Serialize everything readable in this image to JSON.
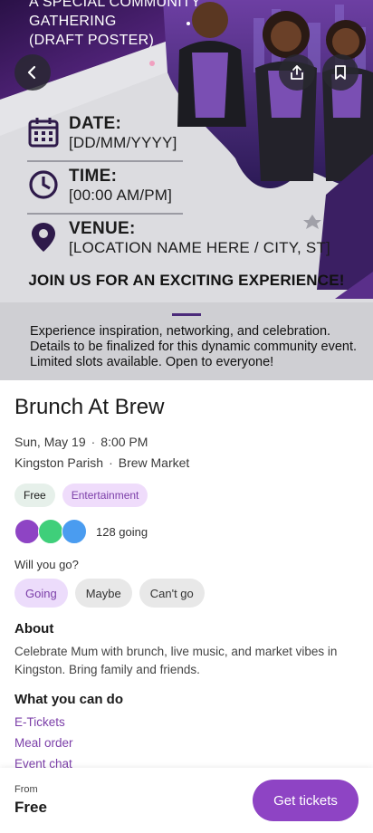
{
  "poster": {
    "heading_line1": "A SPECIAL COMMUNITY",
    "heading_line2": "GATHERING",
    "heading_line3": "(DRAFT POSTER)",
    "date_label": "DATE:",
    "date_value": "[DD/MM/YYYY]",
    "time_label": "TIME:",
    "time_value": "[00:00 AM/PM]",
    "venue_label": "VENUE:",
    "venue_value": "[LOCATION NAME HERE / CITY, ST]",
    "join_text": "JOIN US FOR AN EXCITING EXPERIENCE!",
    "description": "Experience inspiration, networking, and celebration. Details to be finalized for this dynamic community event. Limited slots available. Open to everyone!"
  },
  "header_buttons": {
    "back_icon": "chevron-left-icon",
    "share_icon": "share-icon",
    "bookmark_icon": "bookmark-icon"
  },
  "event": {
    "title": "Brunch At Brew",
    "date": "Sun, May 19",
    "time": "8:00 PM",
    "area": "Kingston Parish",
    "venue": "Brew Market",
    "tags": [
      "Free",
      "Entertainment"
    ],
    "going_count": "128 going",
    "avatar_colors": [
      "#8e44c4",
      "#3fcf7a",
      "#4a9cf0"
    ]
  },
  "rsvp": {
    "question": "Will you go?",
    "options": [
      "Going",
      "Maybe",
      "Can't go"
    ],
    "selected": "Going"
  },
  "about": {
    "heading": "About",
    "text": "Celebrate Mum with brunch, live music, and market vibes in Kingston. Bring family and friends."
  },
  "actions": {
    "heading": "What you can do",
    "links": [
      "E-Tickets",
      "Meal order",
      "Event chat"
    ]
  },
  "footer": {
    "from_label": "From",
    "price": "Free",
    "cta": "Get tickets"
  },
  "colors": {
    "accent": "#8e44c4",
    "accent_light": "#ecdcfb",
    "poster_purple": "#4b2a7a"
  }
}
